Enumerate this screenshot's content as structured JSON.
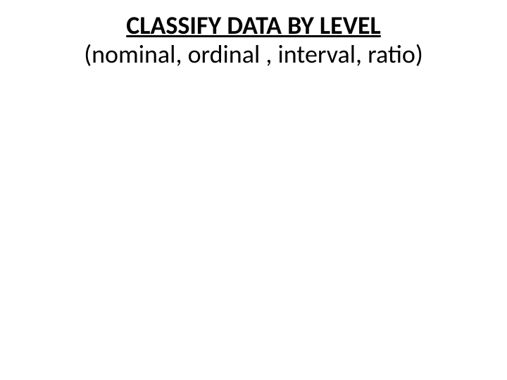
{
  "slide": {
    "title": "CLASSIFY DATA BY LEVEL",
    "subtitle": "(nominal, ordinal , interval, ratio)"
  }
}
